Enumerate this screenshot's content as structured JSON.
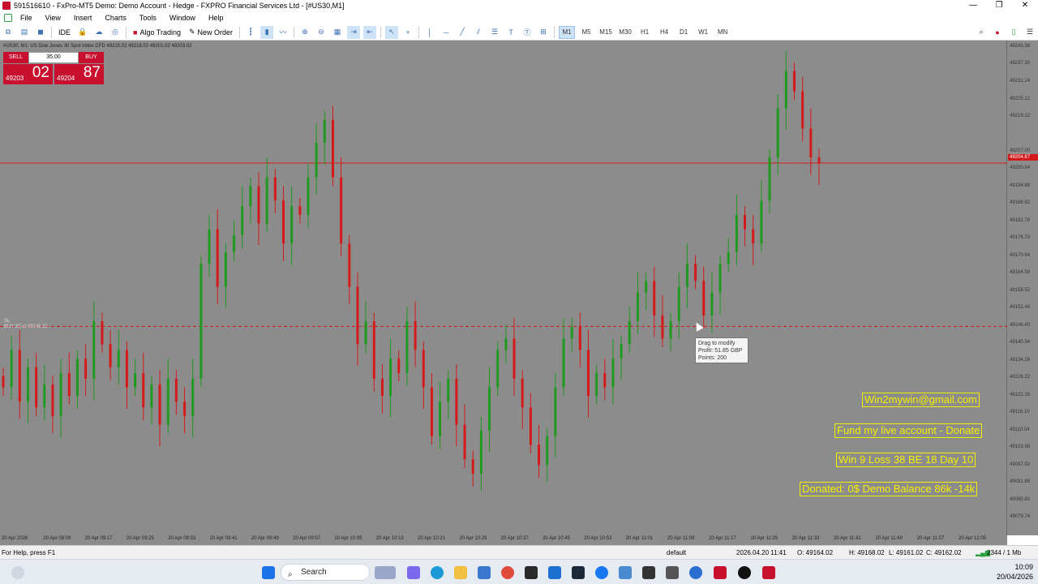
{
  "window": {
    "title": "591516610 - FxPro-MT5 Demo: Demo Account - Hedge - FXPRO Financial Services Ltd - [#US30,M1]",
    "controls": [
      "—",
      "❐",
      "✕"
    ]
  },
  "menu": [
    "File",
    "View",
    "Insert",
    "Charts",
    "Tools",
    "Window",
    "Help"
  ],
  "toolbar": {
    "algo_label": "Algo Trading",
    "new_order_label": "New Order",
    "ide_label": "IDE",
    "timeframes": [
      "M1",
      "M5",
      "M15",
      "M30",
      "H1",
      "H4",
      "D1",
      "W1",
      "MN"
    ],
    "active_timeframe": "M1"
  },
  "chart": {
    "info": "#US30, M1:  US Dow Jones 30 Spot Index CFD   49215.02  49218.02  49201.02  49203.02",
    "one_click": {
      "sell_label": "SELL",
      "buy_label": "BUY",
      "lot": "35.00",
      "sell_small": "49203",
      "sell_big": "02",
      "buy_small": "49204",
      "buy_big": "87"
    },
    "price_axis": [
      "49243.36",
      "49237.30",
      "49231.24",
      "49225.12",
      "49219.12",
      "49207.00",
      "49200.94",
      "49194.88",
      "49188.82",
      "49182.76",
      "49176.70",
      "49170.64",
      "49164.58",
      "49158.52",
      "49152.46",
      "49146.40",
      "49140.34",
      "49134.28",
      "49128.22",
      "49122.16",
      "49116.10",
      "49110.04",
      "49103.98",
      "49097.92",
      "49091.86",
      "49085.80",
      "49079.74"
    ],
    "current_price_label": "49204.87",
    "time_axis": [
      "20 Apr 2026",
      "20 Apr 09:09",
      "20 Apr 09:17",
      "20 Apr 09:25",
      "20 Apr 09:33",
      "20 Apr 09:41",
      "20 Apr 09:49",
      "20 Apr 09:57",
      "20 Apr 10:05",
      "20 Apr 10:13",
      "20 Apr 10:21",
      "20 Apr 10:29",
      "20 Apr 10:37",
      "20 Apr 10:45",
      "20 Apr 10:53",
      "20 Apr 11:01",
      "20 Apr 11:09",
      "20 Apr 11:17",
      "20 Apr 11:25",
      "20 Apr 11:33",
      "20 Apr 11:41",
      "20 Apr 11:49",
      "20 Apr 11:57",
      "20 Apr 12:05"
    ],
    "sl_label": "SL",
    "order_label": "BUY 35 at 49146.22",
    "tooltip": [
      "Drag to modify",
      "Profit: 51.85 GBP",
      "Points: 200"
    ],
    "overlays": [
      "Win2mywin@gmail.com",
      "Fund my live account - Donate",
      "Win 9  Loss 38  BE 18  Day 10",
      "Donated: 0$  Demo Balance 86k -14k"
    ],
    "colors": {
      "background": "#8c8c8c",
      "bull": "#1f9a1f",
      "bear": "#d41a1a",
      "doji": "#e8e000",
      "bid_line": "#d41a1a",
      "overlay_text": "#f5f000"
    }
  },
  "chart_data": {
    "type": "candlestick",
    "symbol": "#US30",
    "timeframe": "M1",
    "ylim": [
      49079.74,
      49243.36
    ],
    "start_time": "20 Apr 2026 09:01",
    "bid": 49203.02,
    "ask": 49204.87,
    "order_price": 49146.22,
    "close_path": [
      49125,
      49138,
      49120,
      49132,
      49118,
      49126,
      49115,
      49130,
      49122,
      49135,
      49128,
      49148,
      49140,
      49132,
      49138,
      49125,
      49130,
      49118,
      49126,
      49112,
      49128,
      49120,
      49115,
      49128,
      49168,
      49180,
      49160,
      49172,
      49178,
      49188,
      49195,
      49182,
      49198,
      49190,
      49175,
      49188,
      49185,
      49198,
      49210,
      49218,
      49198,
      49175,
      49160,
      49140,
      49148,
      49128,
      49122,
      49135,
      49130,
      49148,
      49138,
      49125,
      49108,
      49120,
      49128,
      49112,
      49100,
      49095,
      49110,
      49125,
      49138,
      49142,
      49128,
      49118,
      49105,
      49098,
      49108,
      49125,
      49142,
      49146,
      49138,
      49122,
      49130,
      49125,
      49135,
      49140,
      49148,
      49158,
      49162,
      49150,
      49142,
      49148,
      49160,
      49168,
      49162,
      49150,
      49158,
      49168,
      49172,
      49185,
      49180,
      49175,
      49190,
      49205,
      49222,
      49235,
      49228,
      49215,
      49205,
      49203
    ]
  },
  "status": {
    "help": "For Help, press F1",
    "profile": "default",
    "datetime": "2026.04.20 11:41",
    "open": "O: 49164.02",
    "high": "H: 49168.02",
    "low": "L: 49161.02",
    "close": "C: 49162.02",
    "traffic": "2344 / 1 Mb"
  },
  "taskbar": {
    "search_label": "Search",
    "time": "10:09",
    "date": "20/04/2026"
  }
}
